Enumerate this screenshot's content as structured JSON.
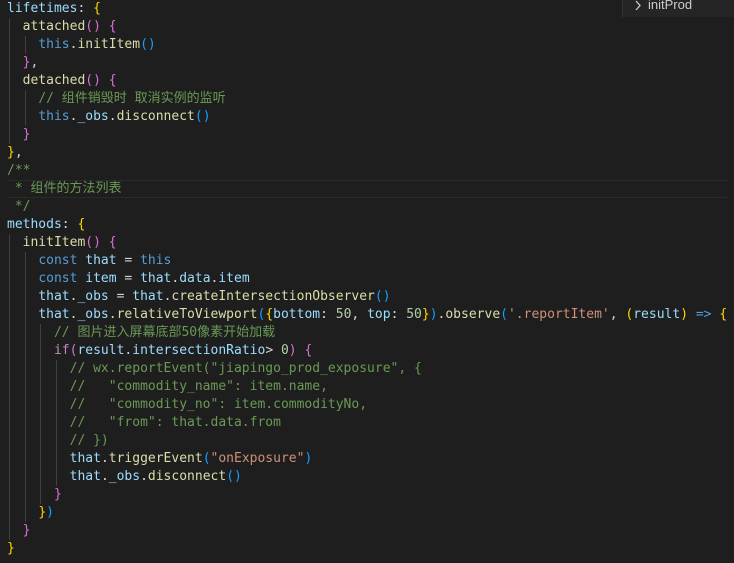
{
  "theme": {
    "background": "#1e1e1e",
    "keyword": "#569cd6",
    "control": "#c586c0",
    "property": "#9cdcfe",
    "function": "#dcdcaa",
    "string": "#ce9178",
    "number": "#b5cea8",
    "comment": "#6a9955",
    "bracket_gold": "#ffd700",
    "bracket_purple": "#da70d6",
    "bracket_blue": "#179fff",
    "text": "#d4d4d4"
  },
  "breadcrumb": {
    "icon": "chevron-right-icon",
    "label": "initProd"
  },
  "code": {
    "lines": [
      {
        "indent": 0,
        "tokens": [
          [
            "lifetimes",
            "property"
          ],
          [
            ": ",
            "text"
          ],
          [
            "{",
            "bracket_gold"
          ]
        ]
      },
      {
        "indent": 1,
        "tokens": [
          [
            "attached",
            "function"
          ],
          [
            "() ",
            "bracket_purple"
          ],
          [
            "{",
            "bracket_purple"
          ]
        ]
      },
      {
        "indent": 2,
        "tokens": [
          [
            "this",
            "keyword"
          ],
          [
            ".",
            "text"
          ],
          [
            "initItem",
            "function"
          ],
          [
            "()",
            "bracket_blue"
          ]
        ]
      },
      {
        "indent": 1,
        "tokens": [
          [
            "}",
            "bracket_purple"
          ],
          [
            ",",
            "text"
          ]
        ]
      },
      {
        "indent": 1,
        "tokens": [
          [
            "detached",
            "function"
          ],
          [
            "() ",
            "bracket_purple"
          ],
          [
            "{",
            "bracket_purple"
          ]
        ]
      },
      {
        "indent": 2,
        "tokens": [
          [
            "// 组件销毁时 取消实例的监听",
            "comment"
          ]
        ]
      },
      {
        "indent": 2,
        "tokens": [
          [
            "this",
            "keyword"
          ],
          [
            ".",
            "text"
          ],
          [
            "_obs",
            "property"
          ],
          [
            ".",
            "text"
          ],
          [
            "disconnect",
            "function"
          ],
          [
            "()",
            "bracket_blue"
          ]
        ]
      },
      {
        "indent": 1,
        "tokens": [
          [
            "}",
            "bracket_purple"
          ]
        ]
      },
      {
        "indent": 0,
        "tokens": [
          [
            "}",
            "bracket_gold"
          ],
          [
            ",",
            "text"
          ]
        ]
      },
      {
        "indent": 0,
        "tokens": [
          [
            "/**",
            "comment"
          ]
        ]
      },
      {
        "indent": 0,
        "hl": true,
        "tokens": [
          [
            " * 组件的方法列表",
            "comment"
          ]
        ]
      },
      {
        "indent": 0,
        "tokens": [
          [
            " */",
            "comment"
          ]
        ]
      },
      {
        "indent": 0,
        "tokens": [
          [
            "methods",
            "property"
          ],
          [
            ": ",
            "text"
          ],
          [
            "{",
            "bracket_gold"
          ]
        ]
      },
      {
        "indent": 1,
        "tokens": [
          [
            "initItem",
            "function"
          ],
          [
            "() ",
            "bracket_purple"
          ],
          [
            "{",
            "bracket_purple"
          ]
        ]
      },
      {
        "indent": 2,
        "tokens": [
          [
            "const ",
            "keyword"
          ],
          [
            "that",
            "property"
          ],
          [
            " = ",
            "text"
          ],
          [
            "this",
            "keyword"
          ]
        ]
      },
      {
        "indent": 2,
        "tokens": [
          [
            "const ",
            "keyword"
          ],
          [
            "item",
            "property"
          ],
          [
            " = ",
            "text"
          ],
          [
            "that",
            "property"
          ],
          [
            ".",
            "text"
          ],
          [
            "data",
            "property"
          ],
          [
            ".",
            "text"
          ],
          [
            "item",
            "property"
          ]
        ]
      },
      {
        "indent": 2,
        "tokens": [
          [
            "that",
            "property"
          ],
          [
            ".",
            "text"
          ],
          [
            "_obs",
            "property"
          ],
          [
            " = ",
            "text"
          ],
          [
            "that",
            "property"
          ],
          [
            ".",
            "text"
          ],
          [
            "createIntersectionObserver",
            "function"
          ],
          [
            "()",
            "bracket_blue"
          ]
        ]
      },
      {
        "indent": 2,
        "tokens": [
          [
            "that",
            "property"
          ],
          [
            ".",
            "text"
          ],
          [
            "_obs",
            "property"
          ],
          [
            ".",
            "text"
          ],
          [
            "relativeToViewport",
            "function"
          ],
          [
            "(",
            "bracket_blue"
          ],
          [
            "{",
            "bracket_gold"
          ],
          [
            "bottom",
            "property"
          ],
          [
            ": ",
            "text"
          ],
          [
            "50",
            "number"
          ],
          [
            ", ",
            "text"
          ],
          [
            "top",
            "property"
          ],
          [
            ": ",
            "text"
          ],
          [
            "50",
            "number"
          ],
          [
            "}",
            "bracket_gold"
          ],
          [
            ")",
            "bracket_blue"
          ],
          [
            ".",
            "text"
          ],
          [
            "observe",
            "function"
          ],
          [
            "(",
            "bracket_blue"
          ],
          [
            "'.reportItem'",
            "string"
          ],
          [
            ", ",
            "text"
          ],
          [
            "(",
            "bracket_gold"
          ],
          [
            "result",
            "property"
          ],
          [
            ")",
            "bracket_gold"
          ],
          [
            " ",
            "text"
          ],
          [
            "=>",
            "keyword"
          ],
          [
            " ",
            "text"
          ],
          [
            "{",
            "bracket_gold"
          ]
        ]
      },
      {
        "indent": 3,
        "tokens": [
          [
            "// 图片进入屏幕底部50像素开始加载",
            "comment"
          ]
        ]
      },
      {
        "indent": 3,
        "tokens": [
          [
            "if",
            "control"
          ],
          [
            "(",
            "bracket_purple"
          ],
          [
            "result",
            "property"
          ],
          [
            ".",
            "text"
          ],
          [
            "intersectionRatio",
            "property"
          ],
          [
            "> ",
            "text"
          ],
          [
            "0",
            "number"
          ],
          [
            ")",
            "bracket_purple"
          ],
          [
            " ",
            "text"
          ],
          [
            "{",
            "bracket_purple"
          ]
        ]
      },
      {
        "indent": 4,
        "tokens": [
          [
            "// wx.reportEvent(\"jiapingo_prod_exposure\", {",
            "comment"
          ]
        ]
      },
      {
        "indent": 4,
        "tokens": [
          [
            "//   \"commodity_name\": item.name,",
            "comment"
          ]
        ]
      },
      {
        "indent": 4,
        "tokens": [
          [
            "//   \"commodity_no\": item.commodityNo,",
            "comment"
          ]
        ]
      },
      {
        "indent": 4,
        "tokens": [
          [
            "//   \"from\": that.data.from",
            "comment"
          ]
        ]
      },
      {
        "indent": 4,
        "tokens": [
          [
            "// })",
            "comment"
          ]
        ]
      },
      {
        "indent": 4,
        "tokens": [
          [
            "that",
            "property"
          ],
          [
            ".",
            "text"
          ],
          [
            "triggerEvent",
            "function"
          ],
          [
            "(",
            "bracket_blue"
          ],
          [
            "\"onExposure\"",
            "string"
          ],
          [
            ")",
            "bracket_blue"
          ]
        ]
      },
      {
        "indent": 4,
        "tokens": [
          [
            "that",
            "property"
          ],
          [
            ".",
            "text"
          ],
          [
            "_obs",
            "property"
          ],
          [
            ".",
            "text"
          ],
          [
            "disconnect",
            "function"
          ],
          [
            "()",
            "bracket_blue"
          ]
        ]
      },
      {
        "indent": 3,
        "tokens": [
          [
            "}",
            "bracket_purple"
          ]
        ]
      },
      {
        "indent": 2,
        "tokens": [
          [
            "}",
            "bracket_gold"
          ],
          [
            ")",
            "bracket_blue"
          ]
        ]
      },
      {
        "indent": 1,
        "tokens": [
          [
            "}",
            "bracket_purple"
          ]
        ]
      },
      {
        "indent": 0,
        "tokens": [
          [
            "}",
            "bracket_gold"
          ]
        ]
      }
    ]
  }
}
